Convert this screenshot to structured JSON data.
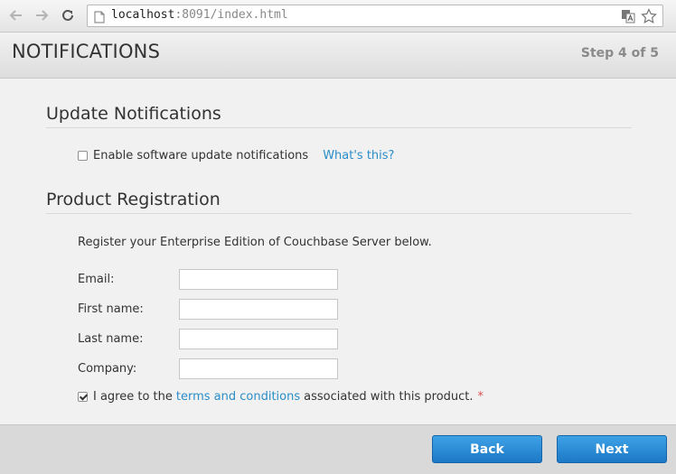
{
  "browser": {
    "url_host": "localhost",
    "url_rest": ":8091/index.html"
  },
  "header": {
    "title": "NOTIFICATIONS",
    "step": "Step 4 of 5"
  },
  "update_section": {
    "title": "Update Notifications",
    "checkbox_label": "Enable software update notifications",
    "checkbox_checked": false,
    "help_link": "What's this?"
  },
  "registration_section": {
    "title": "Product Registration",
    "intro": "Register your Enterprise Edition of Couchbase Server below.",
    "fields": [
      {
        "label": "Email:",
        "value": ""
      },
      {
        "label": "First name:",
        "value": ""
      },
      {
        "label": "Last name:",
        "value": ""
      },
      {
        "label": "Company:",
        "value": ""
      }
    ],
    "agree_prefix": "I agree to the",
    "agree_link": "terms and conditions",
    "agree_suffix": "associated with this product.",
    "agree_required_mark": "*",
    "agree_checked": true
  },
  "footer": {
    "back_label": "Back",
    "next_label": "Next"
  },
  "colors": {
    "link": "#2a8dc8",
    "button": "#1c78c6",
    "required": "#d9534f"
  }
}
